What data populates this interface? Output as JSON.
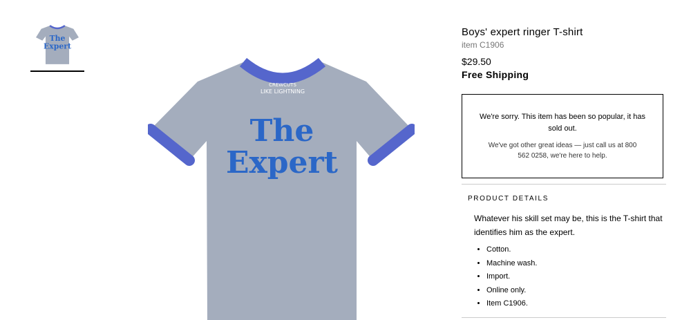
{
  "gallery": {
    "thumbnail_text_line1": "The",
    "thumbnail_text_line2": "Expert"
  },
  "main_image": {
    "print_line1": "The",
    "print_line2": "Expert",
    "collar_text_line1": "CREWCUTS",
    "collar_text_line2": "LIKE LIGHTNING",
    "shirt_color": "#a4adbd",
    "trim_color": "#5566cc",
    "print_color": "#2b67c7"
  },
  "product": {
    "title": "Boys' expert ringer T-shirt",
    "item_number": "item C1906",
    "price": "$29.50",
    "shipping": "Free Shipping"
  },
  "soldout": {
    "message": "We're sorry. This item has been so popular, it has sold out.",
    "help": "We've got other great ideas — just call us at 800 562 0258, we're here to help."
  },
  "details": {
    "heading": "PRODUCT DETAILS",
    "description": "Whatever his skill set may be, this is the T-shirt that identifies him as the expert.",
    "bullets": [
      "Cotton.",
      "Machine wash.",
      "Import.",
      "Online only.",
      "Item C1906."
    ]
  }
}
